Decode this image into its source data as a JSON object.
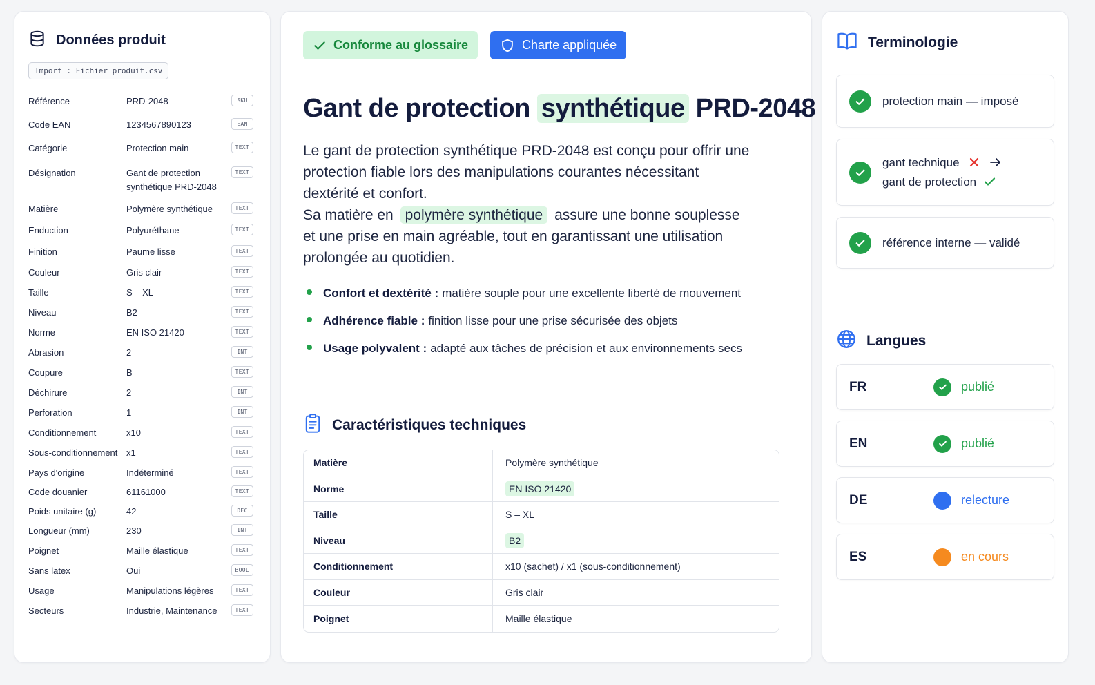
{
  "product_data": {
    "title": "Données produit",
    "import_label": "Import : Fichier produit.csv",
    "attributes": [
      {
        "key": "Référence",
        "value": "PRD-2048",
        "type": "SKU"
      },
      {
        "key": "Code EAN",
        "value": "1234567890123",
        "type": "EAN"
      },
      {
        "key": "Catégorie",
        "value": "Protection main",
        "type": "TEXT"
      },
      {
        "key": "Désignation",
        "value": "Gant de protection synthétique PRD-2048",
        "type": "TEXT"
      },
      {
        "key": "Matière",
        "value": "Polymère synthétique",
        "type": "TEXT"
      },
      {
        "key": "Enduction",
        "value": "Polyuréthane",
        "type": "TEXT"
      },
      {
        "key": "Finition",
        "value": "Paume lisse",
        "type": "TEXT"
      },
      {
        "key": "Couleur",
        "value": "Gris clair",
        "type": "TEXT"
      },
      {
        "key": "Taille",
        "value": "S – XL",
        "type": "TEXT"
      },
      {
        "key": "Niveau",
        "value": "B2",
        "type": "TEXT"
      },
      {
        "key": "Norme",
        "value": "EN ISO 21420",
        "type": "TEXT"
      },
      {
        "key": "Abrasion",
        "value": "2",
        "type": "INT"
      },
      {
        "key": "Coupure",
        "value": "B",
        "type": "TEXT"
      },
      {
        "key": "Déchirure",
        "value": "2",
        "type": "INT"
      },
      {
        "key": "Perforation",
        "value": "1",
        "type": "INT"
      },
      {
        "key": "Conditionnement",
        "value": "x10",
        "type": "TEXT"
      },
      {
        "key": "Sous-conditionnement",
        "value": "x1",
        "type": "TEXT"
      },
      {
        "key": "Pays d'origine",
        "value": "Indéterminé",
        "type": "TEXT"
      },
      {
        "key": "Code douanier",
        "value": "61161000",
        "type": "TEXT"
      },
      {
        "key": "Poids unitaire (g)",
        "value": "42",
        "type": "DEC"
      },
      {
        "key": "Longueur (mm)",
        "value": "230",
        "type": "INT"
      },
      {
        "key": "Poignet",
        "value": "Maille élastique",
        "type": "TEXT"
      },
      {
        "key": "Sans latex",
        "value": "Oui",
        "type": "BOOL"
      },
      {
        "key": "Usage",
        "value": "Manipulations légères",
        "type": "TEXT"
      },
      {
        "key": "Secteurs",
        "value": "Industrie, Maintenance",
        "type": "TEXT"
      }
    ]
  },
  "main": {
    "badge_glossary": "Conforme au glossaire",
    "badge_charter": "Charte appliquée",
    "title_before": "Gant de protection",
    "title_highlight": "synthétique",
    "title_after": "PRD-2048",
    "desc_line1": "Le gant de protection synthétique PRD-2048 est conçu pour offrir une",
    "desc_line2": "protection fiable lors des manipulations courantes nécessitant",
    "desc_line3": "dextérité et confort.",
    "desc_line4_before": "Sa matière en",
    "desc_line4_highlight": "polymère synthétique",
    "desc_line4_after": "assure une bonne souplesse",
    "desc_line5": "et une prise en main agréable, tout en garantissant une utilisation",
    "desc_line6": "prolongée au quotidien.",
    "bullets": [
      {
        "label": "Confort et dextérité :",
        "text": "matière souple pour une excellente liberté de mouvement"
      },
      {
        "label": "Adhérence fiable :",
        "text": "finition lisse pour une prise sécurisée des objets"
      },
      {
        "label": "Usage polyvalent :",
        "text": "adapté aux tâches de précision et aux environnements secs"
      }
    ],
    "specs_title": "Caractéristiques techniques",
    "specs": [
      {
        "key": "Matière",
        "value": "Polymère synthétique",
        "highlight": false
      },
      {
        "key": "Norme",
        "value": "EN ISO 21420",
        "highlight": true
      },
      {
        "key": "Taille",
        "value": "S – XL",
        "highlight": false
      },
      {
        "key": "Niveau",
        "value": "B2",
        "highlight": true
      },
      {
        "key": "Conditionnement",
        "value": "x10 (sachet) / x1 (sous-conditionnement)",
        "highlight": false
      },
      {
        "key": "Couleur",
        "value": "Gris clair",
        "highlight": false
      },
      {
        "key": "Poignet",
        "value": "Maille élastique",
        "highlight": false
      }
    ]
  },
  "terminology": {
    "title": "Terminologie",
    "item1": "protection main — imposé",
    "item2_wrong": "gant technique",
    "item2_right": "gant de protection",
    "item3": "référence interne — validé"
  },
  "languages": {
    "title": "Langues",
    "items": [
      {
        "code": "FR",
        "status": "publié",
        "color": "#22a14a",
        "icon": "check-icon"
      },
      {
        "code": "EN",
        "status": "publié",
        "color": "#22a14a",
        "icon": "check-icon"
      },
      {
        "code": "DE",
        "status": "relecture",
        "color": "#2f6ff0",
        "icon": "dot-icon"
      },
      {
        "code": "ES",
        "status": "en cours",
        "color": "#f58a1f",
        "icon": "dot-icon"
      }
    ]
  },
  "colors": {
    "green": "#22a14a",
    "blue": "#2f6ff0",
    "orange": "#f58a1f",
    "red": "#e5322d",
    "navy": "#141c3d"
  }
}
